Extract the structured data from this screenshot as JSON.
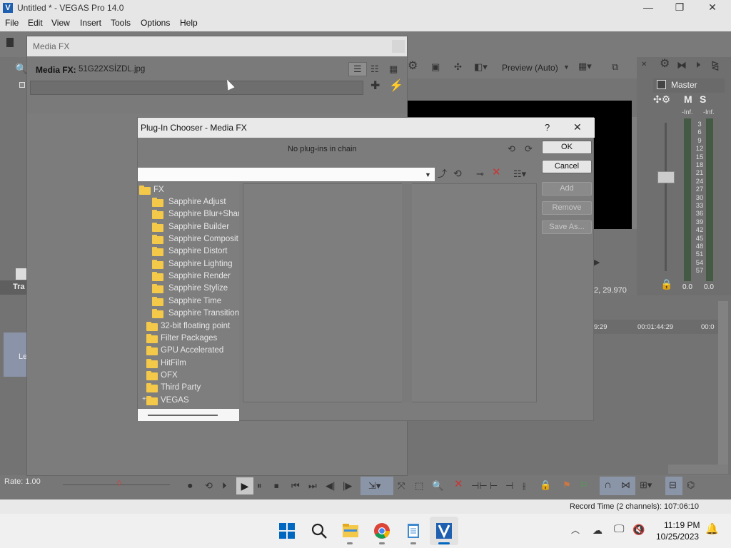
{
  "app": {
    "title": "Untitled * - VEGAS Pro 14.0",
    "menu": [
      "File",
      "Edit",
      "View",
      "Insert",
      "Tools",
      "Options",
      "Help"
    ]
  },
  "preview": {
    "mode": "Preview (Auto)",
    "frame_info": "2, 29.970"
  },
  "mixer": {
    "master_label": "Master",
    "m_label": "M",
    "s_label": "S",
    "inf_left": "-Inf.",
    "inf_right": "-Inf.",
    "scale": [
      "3",
      "6",
      "9",
      "12",
      "15",
      "18",
      "21",
      "24",
      "27",
      "30",
      "33",
      "36",
      "39",
      "42",
      "45",
      "48",
      "51",
      "54",
      "57"
    ],
    "left_value": "0.0",
    "right_value": "0.0"
  },
  "timeline": {
    "tick1": "9:29",
    "tick2": "00:01:44:29",
    "tick3": "00:0",
    "track_label_partial": "Tra",
    "track_name_partial": "Le",
    "rate": "Rate: 1.00",
    "record_time": "Record Time (2 channels): 107:06:10"
  },
  "media_fx": {
    "title": "Media FX",
    "label": "Media FX:",
    "file": "51G22XSİZDL.jpg"
  },
  "chooser": {
    "title": "Plug-In Chooser - Media FX",
    "help_label": "?",
    "close_label": "✕",
    "empty_chain": "No plug-ins in chain",
    "buttons": {
      "ok": "OK",
      "cancel": "Cancel",
      "add": "Add",
      "remove": "Remove",
      "save_as": "Save As..."
    },
    "tree_root": "FX",
    "tree": [
      "Sapphire Adjust",
      "Sapphire Blur+Shar",
      "Sapphire Builder",
      "Sapphire Composit",
      "Sapphire Distort",
      "Sapphire Lighting",
      "Sapphire Render",
      "Sapphire Stylize",
      "Sapphire Time",
      "Sapphire Transition",
      "32-bit floating point",
      "Filter Packages",
      "GPU Accelerated",
      "HitFilm",
      "OFX",
      "Third Party",
      "VEGAS"
    ]
  },
  "taskbar": {
    "time": "11:19 PM",
    "date": "10/25/2023"
  },
  "colors": {
    "folder": "#f4c94a",
    "taskbar_accent": "#0067c0",
    "preview_bg": "#000000"
  }
}
